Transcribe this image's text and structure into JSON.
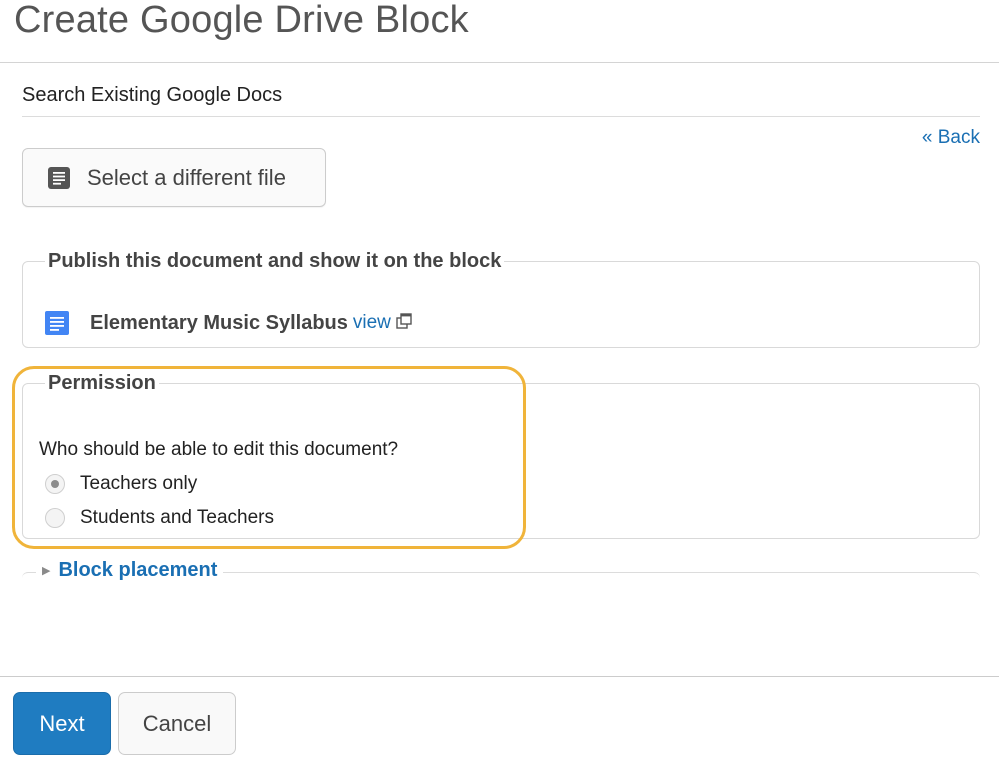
{
  "page": {
    "title": "Create Google Drive Block"
  },
  "search": {
    "label": "Search Existing Google Docs"
  },
  "navigation": {
    "back_label": "« Back"
  },
  "file_select": {
    "button_label": "Select a different file",
    "icon": "document-icon"
  },
  "publish": {
    "legend": "Publish this document and show it on the block",
    "document_name": "Elementary Music Syllabus",
    "view_label": "view",
    "doc_icon": "google-doc-icon",
    "external_icon": "external-link-icon"
  },
  "permission": {
    "legend": "Permission",
    "question": "Who should be able to edit this document?",
    "options": [
      {
        "label": "Teachers only",
        "checked": true
      },
      {
        "label": "Students and Teachers",
        "checked": false
      }
    ]
  },
  "placement": {
    "legend": "Block placement",
    "expanded": false
  },
  "actions": {
    "next_label": "Next",
    "cancel_label": "Cancel"
  },
  "colors": {
    "link": "#1a6fb3",
    "primary_button": "#1f7cc1",
    "highlight": "#f0b43a"
  }
}
